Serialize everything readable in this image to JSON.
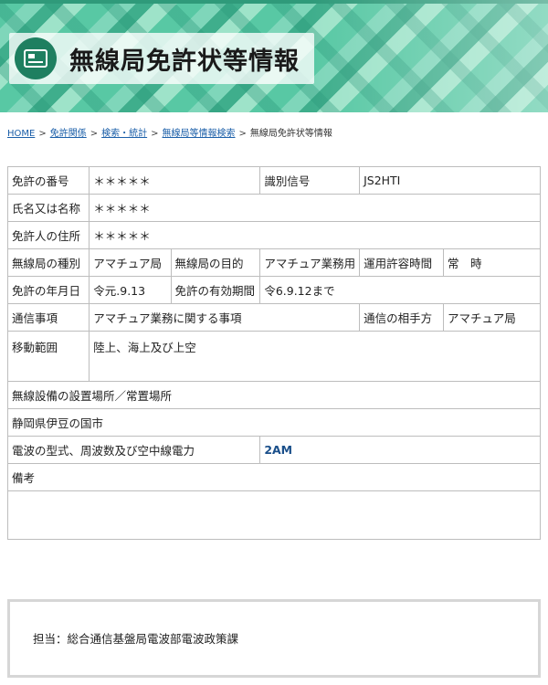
{
  "header": {
    "title": "無線局免許状等情報",
    "icon": "document-icon"
  },
  "breadcrumb": {
    "items": [
      "HOME",
      "免許関係",
      "検索・統計",
      "無線局等情報検索",
      "無線局免許状等情報"
    ],
    "separator": ">"
  },
  "table": {
    "license_number_label": "免許の番号",
    "license_number_value": "＊＊＊＊＊",
    "call_sign_label": "識別信号",
    "call_sign_value": "JS2HTI",
    "name_label": "氏名又は名称",
    "name_value": "＊＊＊＊＊",
    "address_label": "免許人の住所",
    "address_value": "＊＊＊＊＊",
    "station_type_label": "無線局の種別",
    "station_type_value": "アマチュア局",
    "purpose_label": "無線局の目的",
    "purpose_value": "アマチュア業務用",
    "operation_time_label": "運用許容時間",
    "operation_time_value": "常　時",
    "license_date_label": "免許の年月日",
    "license_date_value": "令元.9.13",
    "validity_label": "免許の有効期間",
    "validity_value": "令6.9.12まで",
    "comm_items_label": "通信事項",
    "comm_items_value": "アマチュア業務に関する事項",
    "comm_partner_label": "通信の相手方",
    "comm_partner_value": "アマチュア局",
    "mobile_range_label": "移動範囲",
    "mobile_range_value": "陸上、海上及び上空",
    "equipment_location_label": "無線設備の設置場所／常置場所",
    "equipment_location_value": "静岡県伊豆の国市",
    "radio_spec_label": "電波の型式、周波数及び空中線電力",
    "radio_spec_value": "2AM",
    "remarks_label": "備考",
    "remarks_value": ""
  },
  "footer": {
    "contact": "担当：総合通信基盤局電波部電波政策課"
  },
  "colors": {
    "banner_green": "#58c8a4",
    "icon_green": "#1e7f60",
    "link_blue": "#1a5ea8",
    "value_blue": "#1a4f8a"
  }
}
